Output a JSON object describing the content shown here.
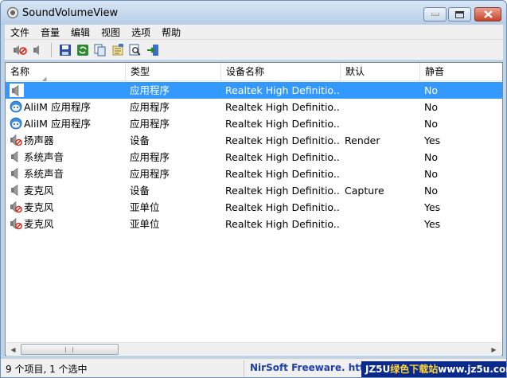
{
  "window": {
    "title": "SoundVolumeView"
  },
  "menu": [
    "文件",
    "音量",
    "编辑",
    "视图",
    "选项",
    "帮助"
  ],
  "toolbar": [
    "mute-icon",
    "unmute-icon",
    "save-icon",
    "refresh-icon",
    "copy-icon",
    "properties-icon",
    "find-icon",
    "exit-icon"
  ],
  "columns": [
    "名称",
    "类型",
    "设备名称",
    "默认",
    "静音"
  ],
  "rows": [
    {
      "icon": "speaker-icon",
      "name": "",
      "type": "应用程序",
      "device": "Realtek High Definitio...",
      "default": "",
      "mute": "No",
      "selected": true
    },
    {
      "icon": "aliim-icon",
      "name": "AliIM 应用程序",
      "type": "应用程序",
      "device": "Realtek High Definitio...",
      "default": "",
      "mute": "No"
    },
    {
      "icon": "aliim-icon",
      "name": "AliIM 应用程序",
      "type": "应用程序",
      "device": "Realtek High Definitio...",
      "default": "",
      "mute": "No"
    },
    {
      "icon": "speaker-muted-icon",
      "name": "扬声器",
      "type": "设备",
      "device": "Realtek High Definitio...",
      "default": "Render",
      "mute": "Yes"
    },
    {
      "icon": "speaker-icon",
      "name": "系统声音",
      "type": "应用程序",
      "device": "Realtek High Definitio...",
      "default": "",
      "mute": "No"
    },
    {
      "icon": "speaker-icon",
      "name": "系统声音",
      "type": "应用程序",
      "device": "Realtek High Definitio...",
      "default": "",
      "mute": "No"
    },
    {
      "icon": "speaker-icon",
      "name": "麦克风",
      "type": "设备",
      "device": "Realtek High Definitio...",
      "default": "Capture",
      "mute": "No"
    },
    {
      "icon": "speaker-muted-icon",
      "name": "麦克风",
      "type": "亚单位",
      "device": "Realtek High Definitio...",
      "default": "",
      "mute": "Yes"
    },
    {
      "icon": "speaker-muted-icon",
      "name": "麦克风",
      "type": "亚单位",
      "device": "Realtek High Definitio...",
      "default": "",
      "mute": "Yes"
    }
  ],
  "status": {
    "left": "9 个项目, 1 个选中",
    "right": "NirSoft Freeware.  http://w"
  },
  "watermark": {
    "part1": "JZ5U",
    "part2": "绿色下载站",
    "part3": "www.jz5u.com"
  }
}
